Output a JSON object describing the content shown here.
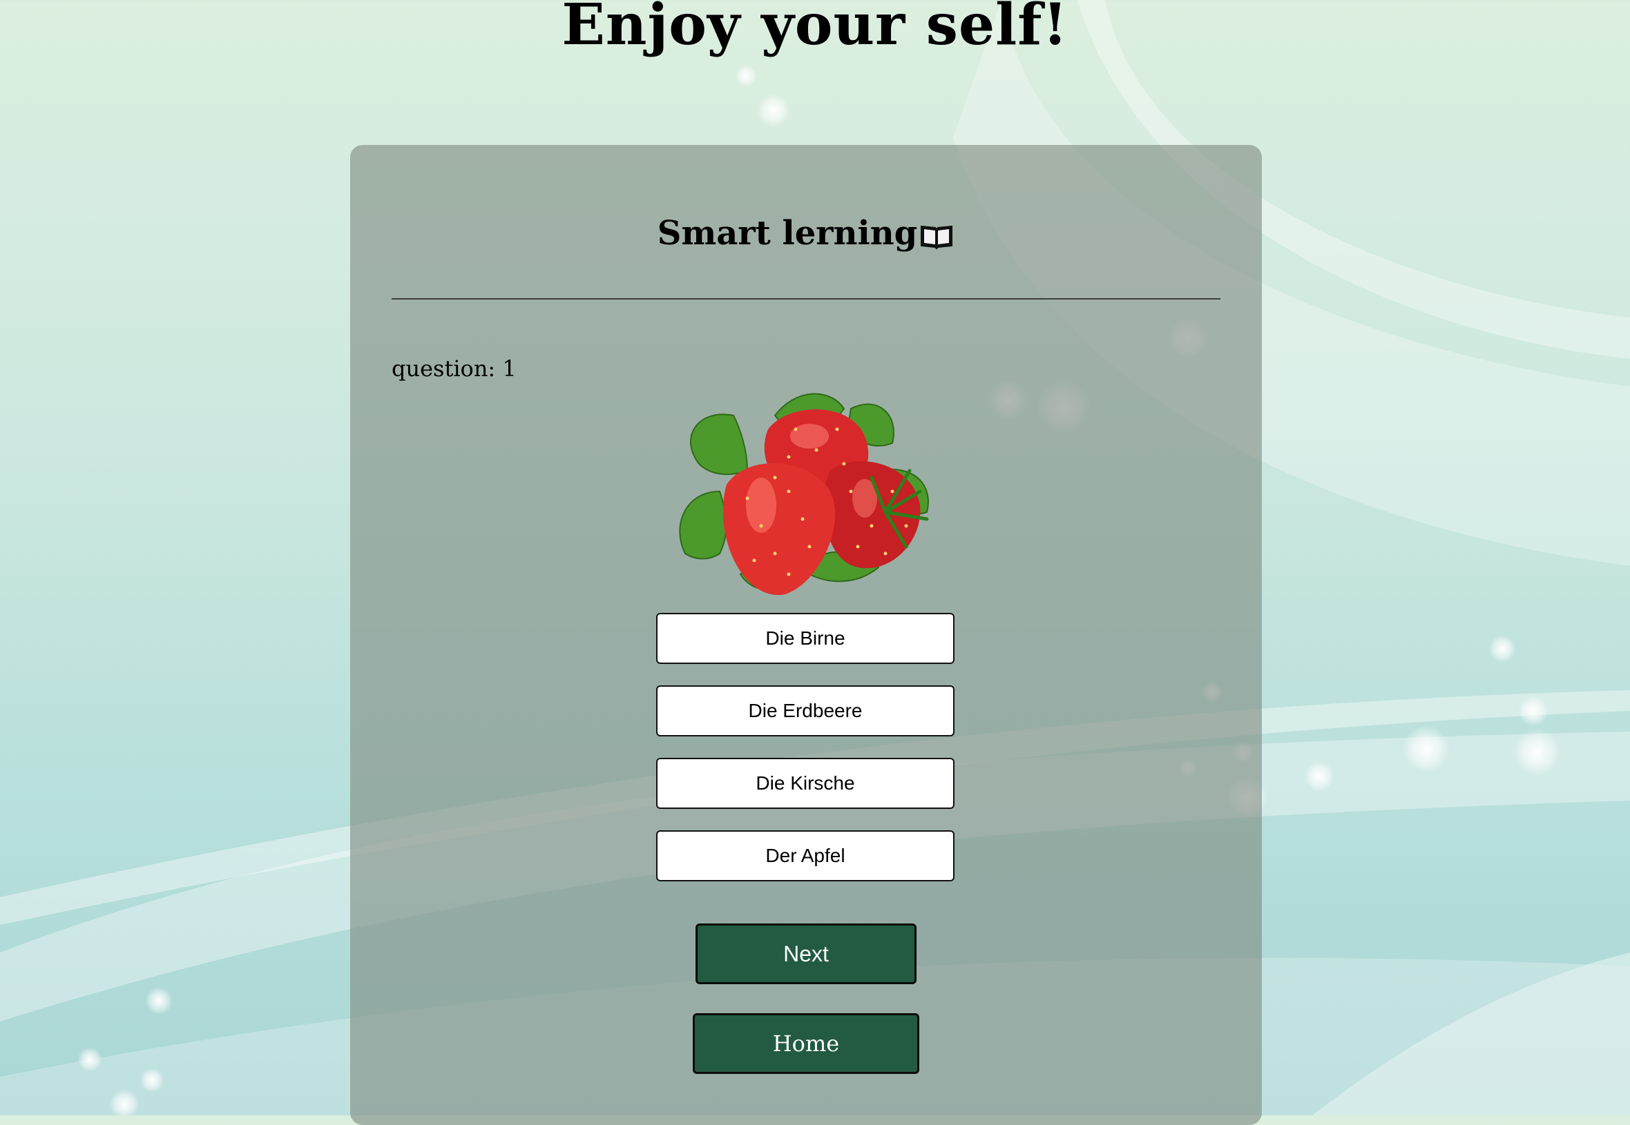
{
  "header": {
    "title": "Enjoy your self!"
  },
  "quiz": {
    "title": "Smart lerning",
    "title_icon": "open-book-icon",
    "question_label": "question: 1",
    "image_subject": "strawberries-image",
    "answers": [
      "Die Birne",
      "Die Erdbeere",
      "Die Kirsche",
      "Der Apfel"
    ],
    "next_label": "Next",
    "home_label": "Home"
  },
  "colors": {
    "button_green": "#225b41",
    "card_overlay": "rgba(128,140,130,0.62)",
    "background": "#cfe9e0"
  }
}
